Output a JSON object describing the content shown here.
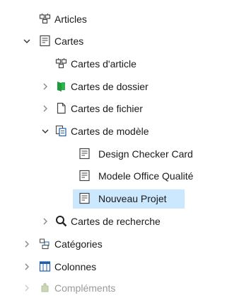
{
  "tree": {
    "items": [
      {
        "label": "Articles",
        "icon": "article-card-icon"
      },
      {
        "label": "Cartes",
        "icon": "card-form-icon",
        "expanded": true
      },
      {
        "label": "Cartes d'article",
        "icon": "article-card-icon"
      },
      {
        "label": "Cartes de dossier",
        "icon": "folder-card-icon",
        "expanded": false
      },
      {
        "label": "Cartes de fichier",
        "icon": "file-card-icon",
        "expanded": false
      },
      {
        "label": "Cartes de modèle",
        "icon": "template-card-icon",
        "expanded": true
      },
      {
        "label": "Design Checker Card",
        "icon": "card-form-icon"
      },
      {
        "label": "Modele Office Qualité",
        "icon": "card-form-icon"
      },
      {
        "label": "Nouveau Projet",
        "icon": "card-form-icon",
        "selected": true
      },
      {
        "label": "Cartes de recherche",
        "icon": "search-icon",
        "expanded": false
      },
      {
        "label": "Catégories",
        "icon": "categories-icon",
        "expanded": false
      },
      {
        "label": "Colonnes",
        "icon": "columns-icon",
        "expanded": false
      },
      {
        "label": "Compléments",
        "icon": "addins-icon",
        "expanded": false
      }
    ]
  },
  "colors": {
    "selection": "#cce8ff",
    "folder_green": "#1e9b3c",
    "accent_blue": "#1f5fa8"
  }
}
